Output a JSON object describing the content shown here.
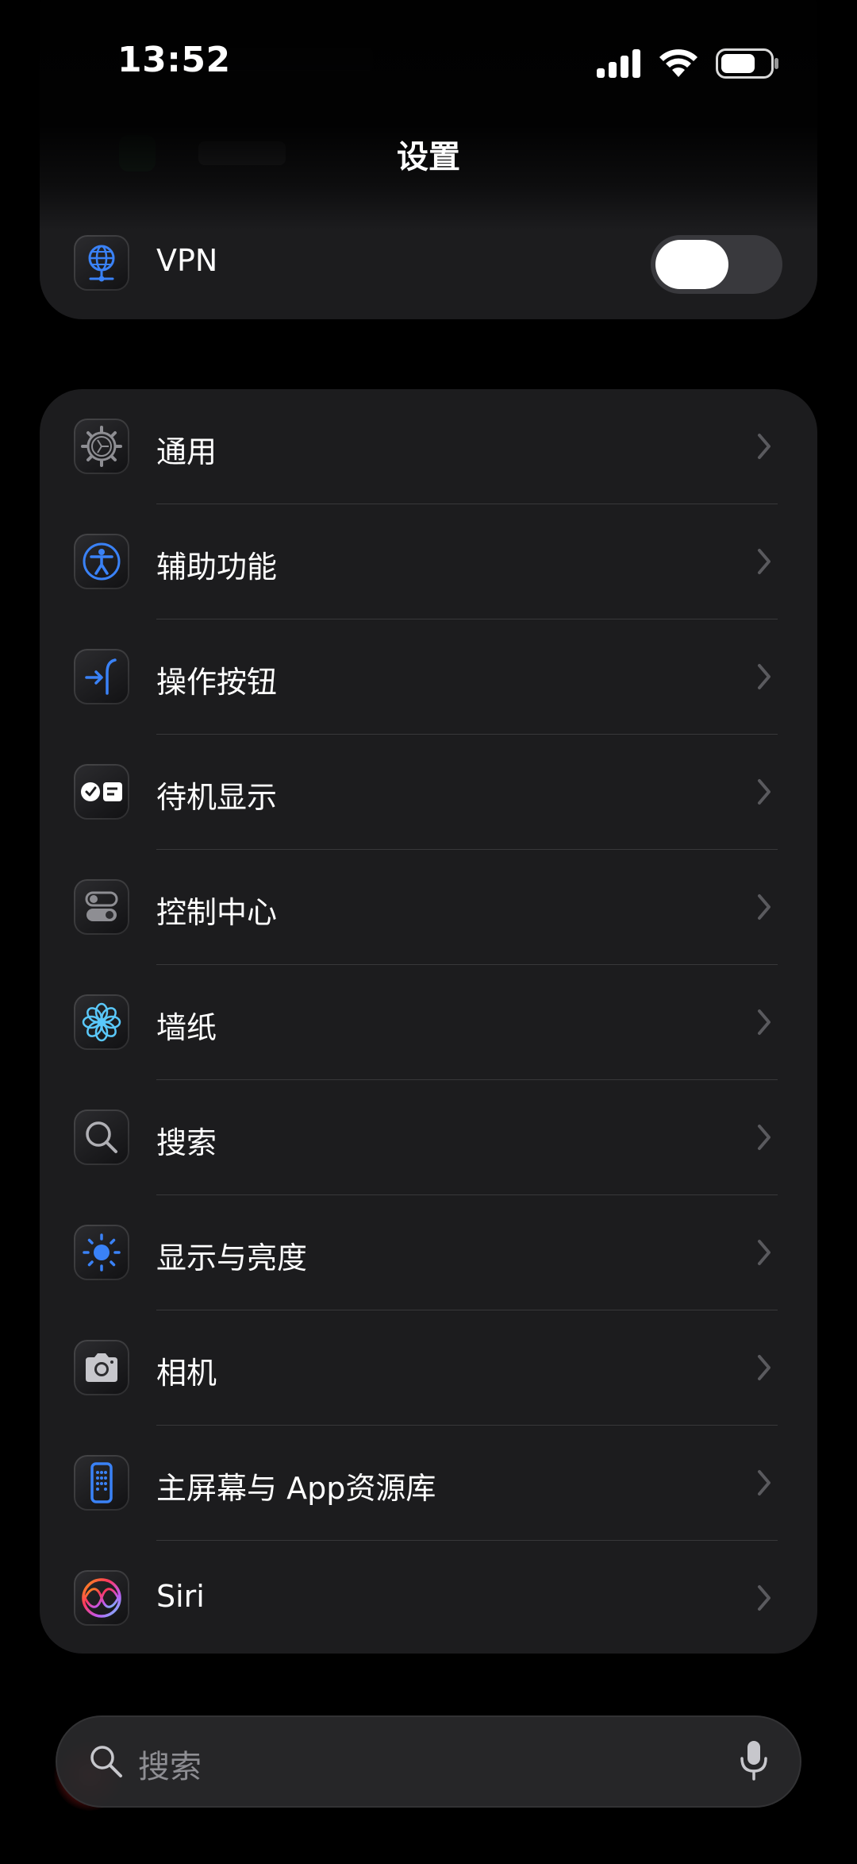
{
  "status_bar": {
    "time": "13:52",
    "icons": [
      "cellular-signal-icon",
      "wifi-icon",
      "battery-icon"
    ],
    "battery_level": 0.7
  },
  "nav": {
    "title": "设置"
  },
  "vpn": {
    "icon": "vpn-globe-icon",
    "label": "VPN",
    "enabled": false
  },
  "settings": {
    "items": [
      {
        "icon": "gear-icon",
        "label": "通用"
      },
      {
        "icon": "accessibility-icon",
        "label": "辅助功能"
      },
      {
        "icon": "action-button-icon",
        "label": "操作按钮"
      },
      {
        "icon": "standby-icon",
        "label": "待机显示"
      },
      {
        "icon": "control-center-icon",
        "label": "控制中心"
      },
      {
        "icon": "wallpaper-flower-icon",
        "label": "墙纸"
      },
      {
        "icon": "magnifier-icon",
        "label": "搜索"
      },
      {
        "icon": "brightness-sun-icon",
        "label": "显示与亮度"
      },
      {
        "icon": "camera-icon",
        "label": "相机"
      },
      {
        "icon": "home-screen-icon",
        "label": "主屏幕与 App资源库"
      },
      {
        "icon": "siri-icon",
        "label": "Siri"
      }
    ]
  },
  "search": {
    "placeholder": "搜索",
    "icons": [
      "search-icon",
      "microphone-icon"
    ]
  },
  "colors": {
    "background": "#000000",
    "group": "#1c1c1e",
    "accent_blue": "#3a82f7",
    "secondary_text": "#8e8e93"
  }
}
